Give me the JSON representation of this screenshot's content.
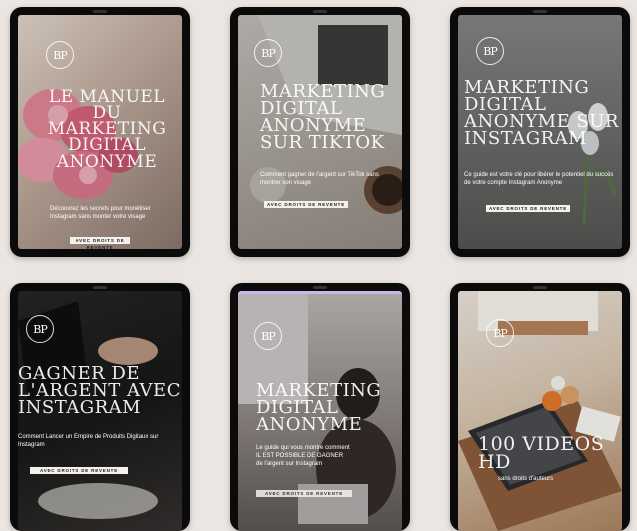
{
  "logo_text": "BP",
  "cards": [
    {
      "title": "LE MANUEL DU MARKETING DIGITAL ANONYME",
      "subtitle": "Découvrez les secrets pour monétiser Instagram sans monter votre visage",
      "badge": "AVEC DROITS DE REVENTE"
    },
    {
      "title": "MARKETING DIGITAL ANONYME SUR TIKTOK",
      "subtitle": "Comment gagner de l'argent sur TikTok sans montrer son visage",
      "badge": "AVEC DROITS DE REVENTE"
    },
    {
      "title": "MARKETING DIGITAL ANONYME SUR INSTAGRAM",
      "subtitle": "Ce guide est votre clé pour libérer le potentiel du succès de votre compte Instagram Anonyme",
      "badge": "AVEC DROITS DE REVENTE"
    },
    {
      "title": "GAGNER DE L'ARGENT AVEC INSTAGRAM",
      "subtitle": "Comment Lancer un Empire de Produits Digitaux sur Instagram",
      "badge": "AVEC DROITS DE REVENTE"
    },
    {
      "title": "MARKETING DIGITAL ANONYME",
      "subtitle_lines": [
        "Le guide qui vous montre comment",
        "IL EST POSSIBLE DE GAGNER",
        "de l'argent sur Instagram"
      ],
      "badge": "AVEC DROITS DE REVENTE"
    },
    {
      "title": "100 VIDEOS HD",
      "subtitle": "sans droits d'auteurs"
    }
  ]
}
